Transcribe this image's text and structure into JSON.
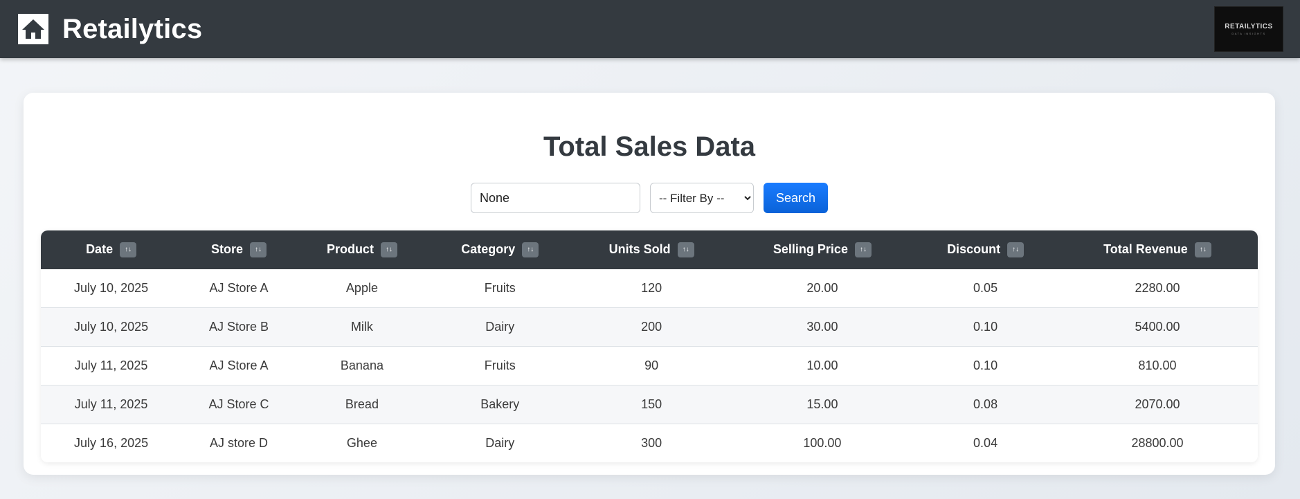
{
  "app": {
    "name": "Retailytics",
    "logo_text": "RETAILYTICS",
    "logo_subtext": "DATA INSIGHTS"
  },
  "page": {
    "title": "Total Sales Data"
  },
  "search": {
    "value": "None"
  },
  "filter": {
    "selected": "-- Filter By --"
  },
  "search_button": {
    "label": "Search"
  },
  "sort_icon": "↑↓",
  "table": {
    "columns": [
      "Date",
      "Store",
      "Product",
      "Category",
      "Units Sold",
      "Selling Price",
      "Discount",
      "Total Revenue"
    ],
    "rows": [
      [
        "July 10, 2025",
        "AJ Store A",
        "Apple",
        "Fruits",
        "120",
        "20.00",
        "0.05",
        "2280.00"
      ],
      [
        "July 10, 2025",
        "AJ Store B",
        "Milk",
        "Dairy",
        "200",
        "30.00",
        "0.10",
        "5400.00"
      ],
      [
        "July 11, 2025",
        "AJ Store A",
        "Banana",
        "Fruits",
        "90",
        "10.00",
        "0.10",
        "810.00"
      ],
      [
        "July 11, 2025",
        "AJ Store C",
        "Bread",
        "Bakery",
        "150",
        "15.00",
        "0.08",
        "2070.00"
      ],
      [
        "July 16, 2025",
        "AJ store D",
        "Ghee",
        "Dairy",
        "300",
        "100.00",
        "0.04",
        "28800.00"
      ]
    ]
  },
  "colors": {
    "navbar": "#343a40",
    "accent": "#0d6efd",
    "sort_badge": "#6c757d"
  }
}
